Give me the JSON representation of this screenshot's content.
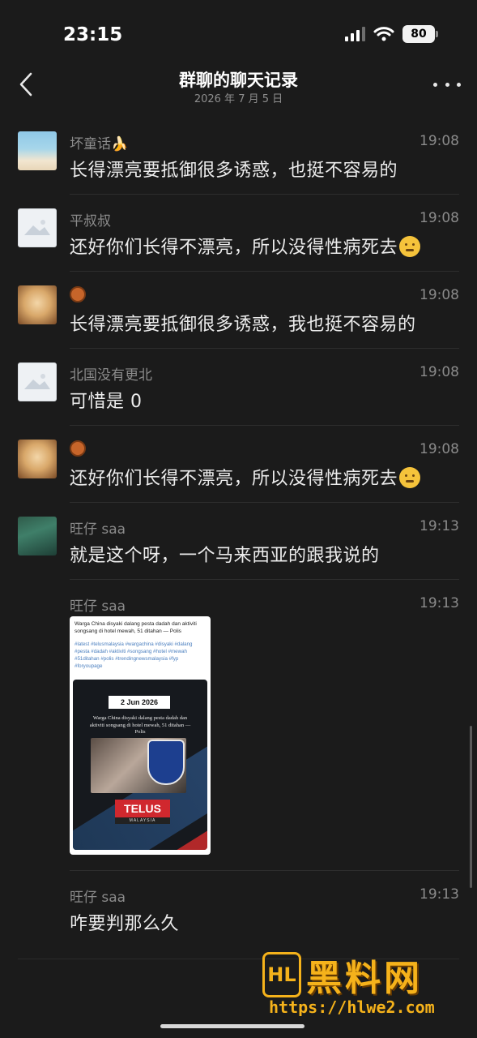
{
  "status_bar": {
    "time": "23:15",
    "battery": "80"
  },
  "header": {
    "title": "群聊的聊天记录",
    "subtitle": "2026 年 7 月 5 日"
  },
  "messages": [
    {
      "name": "坏童话🍌",
      "time": "19:08",
      "text": "长得漂亮要抵御很多诱惑，也挺不容易的"
    },
    {
      "name": "平叔叔",
      "time": "19:08",
      "text": "还好你们长得不漂亮，所以没得性病死去"
    },
    {
      "name": "",
      "time": "19:08",
      "text": "长得漂亮要抵御很多诱惑，我也挺不容易的"
    },
    {
      "name": "北国没有更北",
      "time": "19:08",
      "text": "可惜是 0"
    },
    {
      "name": "",
      "time": "19:08",
      "text": "还好你们长得不漂亮，所以没得性病死去"
    },
    {
      "name": "旺仔 saa",
      "time": "19:13",
      "text": "就是这个呀，一个马来西亚的跟我说的"
    },
    {
      "name": "旺仔 saa",
      "time": "19:13"
    },
    {
      "name": "旺仔 saa",
      "time": "19:13",
      "text": "咋要判那么久"
    }
  ],
  "post": {
    "title": "Warga China disyaki dalang pesta dadah dan aktiviti songsang di hotel mewah, 51 ditahan — Polis",
    "tags": "#latest #telusmalaysia #wargachina #disyaki #dalang #pesta #dadah #aktiviti #songsang #hotel #mewah #51ditahan #polis #trendingnewsmalaysia #fyp #foryoupage",
    "date": "2 Jun 2026",
    "headline": "Warga China disyaki dalang pesta dadah dan aktiviti songsang di hotel mewah, 51 ditahan — Polis",
    "logo": "TELUS",
    "logo_sub": "MALAYSIA"
  },
  "watermark": {
    "logo": "HL",
    "title": "黑料网",
    "url": "https://hlwe2.com"
  },
  "icons": {
    "back": "chevron-left-icon",
    "more": "more-dots-icon",
    "signal": "signal-icon",
    "wifi": "wifi-icon",
    "battery": "battery-icon",
    "emoji": "thinking-face-icon",
    "basketball": "basketball-icon"
  }
}
